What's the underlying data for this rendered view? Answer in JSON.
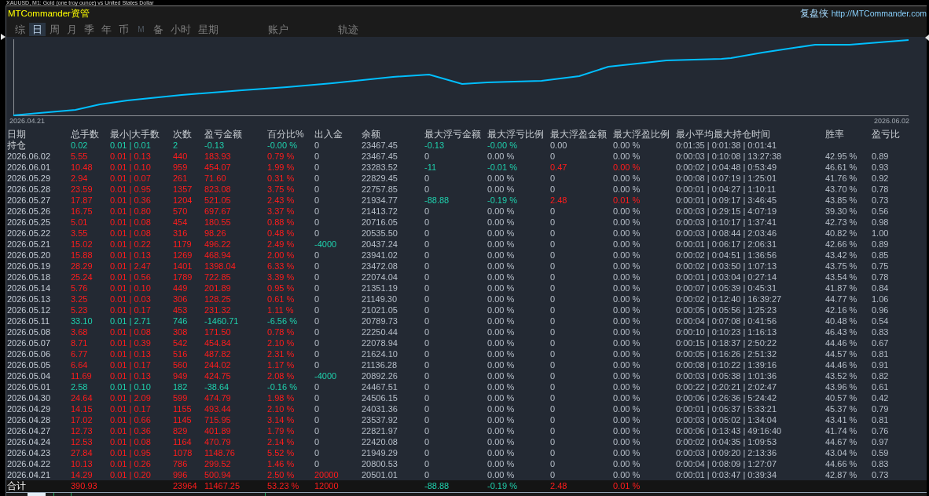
{
  "window": {
    "title": "XAUUSD, M1: Gold (one troy ounce) vs United States Dollar"
  },
  "header": {
    "brand": "MTCommander资管",
    "product": "复盘侠",
    "link": "http://MTCommander.com"
  },
  "tabs": [
    {
      "label": "综",
      "selected": false,
      "disabled": false
    },
    {
      "label": "日",
      "selected": true,
      "disabled": false
    },
    {
      "label": "周",
      "selected": false,
      "disabled": false
    },
    {
      "label": "月",
      "selected": false,
      "disabled": false
    },
    {
      "label": "季",
      "selected": false,
      "disabled": false
    },
    {
      "label": "年",
      "selected": false,
      "disabled": false
    },
    {
      "label": "币",
      "selected": false,
      "disabled": false
    },
    {
      "label": "M",
      "selected": false,
      "disabled": true
    },
    {
      "label": "备",
      "selected": false,
      "disabled": false
    },
    {
      "label": "小时",
      "selected": false,
      "disabled": false
    },
    {
      "label": "星期",
      "selected": false,
      "disabled": false
    },
    {
      "label": "账户",
      "selected": false,
      "disabled": false
    },
    {
      "label": "轨迹",
      "selected": false,
      "disabled": false
    }
  ],
  "equity_chart": {
    "start_label": "2026.04.21",
    "end_label": "2026.06.02"
  },
  "table": {
    "columns": [
      "日期",
      "总手数",
      "最小|大手数",
      "次数",
      "盈亏金额",
      "百分比%",
      "出入金",
      "余额",
      "最大浮亏金额",
      "最大浮亏比例",
      "最大浮盈金额",
      "最大浮盈比例",
      "最小平均最大持仓时间",
      "胜率",
      "盈亏比"
    ],
    "position_row": {
      "label": "持仓",
      "loss": true,
      "lots": "0.02",
      "lot_range": "0.01 | 0.01",
      "trades": "2",
      "profit": "-0.13",
      "percent": "-0.00 %",
      "cash_flow": "0",
      "deposit": false,
      "withdrawal": false,
      "balance": "23467.45",
      "float_loss": "-0.13",
      "float_loss_pct": "-0.00 %",
      "float_loss_hit": true,
      "float_gain": "0.00",
      "float_gain_pct": "0.00 %",
      "float_gain_hit": false,
      "hold_times": "0:01:35 | 0:01:38 | 0:01:41"
    },
    "rows": [
      {
        "label": "2026.06.02",
        "loss": false,
        "lots": "5.55",
        "lot_range": "0.01 | 0.13",
        "trades": "440",
        "profit": "183.93",
        "percent": "0.79 %",
        "cash_flow": "0",
        "deposit": false,
        "withdrawal": false,
        "balance": "23467.45",
        "float_loss": "0",
        "float_loss_pct": "0.00 %",
        "float_loss_hit": false,
        "float_gain": "0",
        "float_gain_pct": "0.00 %",
        "float_gain_hit": false,
        "hold_times": "0:00:03 | 0:10:08 | 13:27:38",
        "win_rate": "42.95 %",
        "pl_ratio": "0.89"
      },
      {
        "label": "2026.06.01",
        "loss": false,
        "lots": "10.48",
        "lot_range": "0.01 | 0.10",
        "trades": "959",
        "profit": "454.07",
        "percent": "1.99 %",
        "cash_flow": "0",
        "deposit": false,
        "withdrawal": false,
        "balance": "23283.52",
        "float_loss": "-11",
        "float_loss_pct": "-0.01 %",
        "float_loss_hit": true,
        "float_gain": "0.47",
        "float_gain_pct": "0.00 %",
        "float_gain_hit": true,
        "hold_times": "0:00:02 | 0:04:48 | 0:53:49",
        "win_rate": "46.61 %",
        "pl_ratio": "0.93"
      },
      {
        "label": "2026.05.29",
        "loss": false,
        "lots": "2.94",
        "lot_range": "0.01 | 0.07",
        "trades": "261",
        "profit": "71.60",
        "percent": "0.31 %",
        "cash_flow": "0",
        "deposit": false,
        "withdrawal": false,
        "balance": "22829.45",
        "float_loss": "0",
        "float_loss_pct": "0.00 %",
        "float_loss_hit": false,
        "float_gain": "0",
        "float_gain_pct": "0.00 %",
        "float_gain_hit": false,
        "hold_times": "0:00:08 | 0:07:19 | 1:25:01",
        "win_rate": "41.76 %",
        "pl_ratio": "0.92"
      },
      {
        "label": "2026.05.28",
        "loss": false,
        "lots": "23.59",
        "lot_range": "0.01 | 0.95",
        "trades": "1357",
        "profit": "823.08",
        "percent": "3.75 %",
        "cash_flow": "0",
        "deposit": false,
        "withdrawal": false,
        "balance": "22757.85",
        "float_loss": "0",
        "float_loss_pct": "0.00 %",
        "float_loss_hit": false,
        "float_gain": "0",
        "float_gain_pct": "0.00 %",
        "float_gain_hit": false,
        "hold_times": "0:00:01 | 0:04:27 | 1:10:11",
        "win_rate": "43.70 %",
        "pl_ratio": "0.78"
      },
      {
        "label": "2026.05.27",
        "loss": false,
        "lots": "17.87",
        "lot_range": "0.01 | 0.36",
        "trades": "1204",
        "profit": "521.05",
        "percent": "2.43 %",
        "cash_flow": "0",
        "deposit": false,
        "withdrawal": false,
        "balance": "21934.77",
        "float_loss": "-88.88",
        "float_loss_pct": "-0.19 %",
        "float_loss_hit": true,
        "float_gain": "2.48",
        "float_gain_pct": "0.01 %",
        "float_gain_hit": true,
        "hold_times": "0:00:01 | 0:09:17 | 3:46:45",
        "win_rate": "43.85 %",
        "pl_ratio": "0.73"
      },
      {
        "label": "2026.05.26",
        "loss": false,
        "lots": "16.75",
        "lot_range": "0.01 | 0.80",
        "trades": "570",
        "profit": "697.67",
        "percent": "3.37 %",
        "cash_flow": "0",
        "deposit": false,
        "withdrawal": false,
        "balance": "21413.72",
        "float_loss": "0",
        "float_loss_pct": "0.00 %",
        "float_loss_hit": false,
        "float_gain": "0",
        "float_gain_pct": "0.00 %",
        "float_gain_hit": false,
        "hold_times": "0:00:03 | 0:29:15 | 4:07:19",
        "win_rate": "39.30 %",
        "pl_ratio": "0.56"
      },
      {
        "label": "2026.05.25",
        "loss": false,
        "lots": "5.01",
        "lot_range": "0.01 | 0.08",
        "trades": "454",
        "profit": "180.55",
        "percent": "0.88 %",
        "cash_flow": "0",
        "deposit": false,
        "withdrawal": false,
        "balance": "20716.05",
        "float_loss": "0",
        "float_loss_pct": "0.00 %",
        "float_loss_hit": false,
        "float_gain": "0",
        "float_gain_pct": "0.00 %",
        "float_gain_hit": false,
        "hold_times": "0:00:03 | 0:10:17 | 1:37:41",
        "win_rate": "42.73 %",
        "pl_ratio": "0.98"
      },
      {
        "label": "2026.05.22",
        "loss": false,
        "lots": "3.55",
        "lot_range": "0.01 | 0.08",
        "trades": "316",
        "profit": "98.26",
        "percent": "0.48 %",
        "cash_flow": "0",
        "deposit": false,
        "withdrawal": false,
        "balance": "20535.50",
        "float_loss": "0",
        "float_loss_pct": "0.00 %",
        "float_loss_hit": false,
        "float_gain": "0",
        "float_gain_pct": "0.00 %",
        "float_gain_hit": false,
        "hold_times": "0:00:03 | 0:08:44 | 2:03:46",
        "win_rate": "40.82 %",
        "pl_ratio": "1.00"
      },
      {
        "label": "2026.05.21",
        "loss": false,
        "lots": "15.02",
        "lot_range": "0.01 | 0.22",
        "trades": "1179",
        "profit": "496.22",
        "percent": "2.49 %",
        "cash_flow": "-4000",
        "deposit": false,
        "withdrawal": true,
        "balance": "20437.24",
        "float_loss": "0",
        "float_loss_pct": "0.00 %",
        "float_loss_hit": false,
        "float_gain": "0",
        "float_gain_pct": "0.00 %",
        "float_gain_hit": false,
        "hold_times": "0:00:01 | 0:06:17 | 2:06:31",
        "win_rate": "42.66 %",
        "pl_ratio": "0.89"
      },
      {
        "label": "2026.05.20",
        "loss": false,
        "lots": "15.88",
        "lot_range": "0.01 | 0.13",
        "trades": "1269",
        "profit": "468.94",
        "percent": "2.00 %",
        "cash_flow": "0",
        "deposit": false,
        "withdrawal": false,
        "balance": "23941.02",
        "float_loss": "0",
        "float_loss_pct": "0.00 %",
        "float_loss_hit": false,
        "float_gain": "0",
        "float_gain_pct": "0.00 %",
        "float_gain_hit": false,
        "hold_times": "0:00:02 | 0:04:51 | 1:36:56",
        "win_rate": "43.42 %",
        "pl_ratio": "0.85"
      },
      {
        "label": "2026.05.19",
        "loss": false,
        "lots": "28.29",
        "lot_range": "0.01 | 2.47",
        "trades": "1401",
        "profit": "1398.04",
        "percent": "6.33 %",
        "cash_flow": "0",
        "deposit": false,
        "withdrawal": false,
        "balance": "23472.08",
        "float_loss": "0",
        "float_loss_pct": "0.00 %",
        "float_loss_hit": false,
        "float_gain": "0",
        "float_gain_pct": "0.00 %",
        "float_gain_hit": false,
        "hold_times": "0:00:02 | 0:03:50 | 1:07:13",
        "win_rate": "43.75 %",
        "pl_ratio": "0.75"
      },
      {
        "label": "2026.05.18",
        "loss": false,
        "lots": "25.24",
        "lot_range": "0.01 | 0.56",
        "trades": "1789",
        "profit": "722.85",
        "percent": "3.39 %",
        "cash_flow": "0",
        "deposit": false,
        "withdrawal": false,
        "balance": "22074.04",
        "float_loss": "0",
        "float_loss_pct": "0.00 %",
        "float_loss_hit": false,
        "float_gain": "0",
        "float_gain_pct": "0.00 %",
        "float_gain_hit": false,
        "hold_times": "0:00:01 | 0:03:04 | 0:27:14",
        "win_rate": "43.54 %",
        "pl_ratio": "0.78"
      },
      {
        "label": "2026.05.14",
        "loss": false,
        "lots": "5.76",
        "lot_range": "0.01 | 0.10",
        "trades": "449",
        "profit": "201.89",
        "percent": "0.95 %",
        "cash_flow": "0",
        "deposit": false,
        "withdrawal": false,
        "balance": "21351.19",
        "float_loss": "0",
        "float_loss_pct": "0.00 %",
        "float_loss_hit": false,
        "float_gain": "0",
        "float_gain_pct": "0.00 %",
        "float_gain_hit": false,
        "hold_times": "0:00:07 | 0:05:39 | 0:45:31",
        "win_rate": "41.87 %",
        "pl_ratio": "0.84"
      },
      {
        "label": "2026.05.13",
        "loss": false,
        "lots": "3.25",
        "lot_range": "0.01 | 0.03",
        "trades": "306",
        "profit": "128.25",
        "percent": "0.61 %",
        "cash_flow": "0",
        "deposit": false,
        "withdrawal": false,
        "balance": "21149.30",
        "float_loss": "0",
        "float_loss_pct": "0.00 %",
        "float_loss_hit": false,
        "float_gain": "0",
        "float_gain_pct": "0.00 %",
        "float_gain_hit": false,
        "hold_times": "0:00:02 | 0:12:40 | 16:39:27",
        "win_rate": "44.77 %",
        "pl_ratio": "1.06"
      },
      {
        "label": "2026.05.12",
        "loss": false,
        "lots": "5.23",
        "lot_range": "0.01 | 0.17",
        "trades": "453",
        "profit": "231.32",
        "percent": "1.11 %",
        "cash_flow": "0",
        "deposit": false,
        "withdrawal": false,
        "balance": "21021.05",
        "float_loss": "0",
        "float_loss_pct": "0.00 %",
        "float_loss_hit": false,
        "float_gain": "0",
        "float_gain_pct": "0.00 %",
        "float_gain_hit": false,
        "hold_times": "0:00:05 | 0:05:56 | 1:25:23",
        "win_rate": "42.16 %",
        "pl_ratio": "0.96"
      },
      {
        "label": "2026.05.11",
        "loss": true,
        "lots": "33.10",
        "lot_range": "0.01 | 2.71",
        "trades": "746",
        "profit": "-1460.71",
        "percent": "-6.56 %",
        "cash_flow": "0",
        "deposit": false,
        "withdrawal": false,
        "balance": "20789.73",
        "float_loss": "0",
        "float_loss_pct": "0.00 %",
        "float_loss_hit": false,
        "float_gain": "0",
        "float_gain_pct": "0.00 %",
        "float_gain_hit": false,
        "hold_times": "0:00:04 | 0:07:08 | 0:41:56",
        "win_rate": "40.48 %",
        "pl_ratio": "0.54"
      },
      {
        "label": "2026.05.08",
        "loss": false,
        "lots": "3.68",
        "lot_range": "0.01 | 0.08",
        "trades": "308",
        "profit": "171.50",
        "percent": "0.78 %",
        "cash_flow": "0",
        "deposit": false,
        "withdrawal": false,
        "balance": "22250.44",
        "float_loss": "0",
        "float_loss_pct": "0.00 %",
        "float_loss_hit": false,
        "float_gain": "0",
        "float_gain_pct": "0.00 %",
        "float_gain_hit": false,
        "hold_times": "0:00:10 | 0:10:23 | 1:16:13",
        "win_rate": "46.43 %",
        "pl_ratio": "0.83"
      },
      {
        "label": "2026.05.07",
        "loss": false,
        "lots": "8.71",
        "lot_range": "0.01 | 0.39",
        "trades": "542",
        "profit": "454.84",
        "percent": "2.10 %",
        "cash_flow": "0",
        "deposit": false,
        "withdrawal": false,
        "balance": "22078.94",
        "float_loss": "0",
        "float_loss_pct": "0.00 %",
        "float_loss_hit": false,
        "float_gain": "0",
        "float_gain_pct": "0.00 %",
        "float_gain_hit": false,
        "hold_times": "0:00:15 | 0:18:37 | 2:50:22",
        "win_rate": "44.46 %",
        "pl_ratio": "0.67"
      },
      {
        "label": "2026.05.06",
        "loss": false,
        "lots": "6.77",
        "lot_range": "0.01 | 0.13",
        "trades": "516",
        "profit": "487.82",
        "percent": "2.31 %",
        "cash_flow": "0",
        "deposit": false,
        "withdrawal": false,
        "balance": "21624.10",
        "float_loss": "0",
        "float_loss_pct": "0.00 %",
        "float_loss_hit": false,
        "float_gain": "0",
        "float_gain_pct": "0.00 %",
        "float_gain_hit": false,
        "hold_times": "0:00:05 | 0:16:26 | 2:51:32",
        "win_rate": "44.57 %",
        "pl_ratio": "0.81"
      },
      {
        "label": "2026.05.05",
        "loss": false,
        "lots": "6.64",
        "lot_range": "0.01 | 0.17",
        "trades": "560",
        "profit": "244.02",
        "percent": "1.17 %",
        "cash_flow": "0",
        "deposit": false,
        "withdrawal": false,
        "balance": "21136.28",
        "float_loss": "0",
        "float_loss_pct": "0.00 %",
        "float_loss_hit": false,
        "float_gain": "0",
        "float_gain_pct": "0.00 %",
        "float_gain_hit": false,
        "hold_times": "0:00:08 | 0:10:22 | 1:39:16",
        "win_rate": "44.46 %",
        "pl_ratio": "0.91"
      },
      {
        "label": "2026.05.04",
        "loss": false,
        "lots": "11.69",
        "lot_range": "0.01 | 0.13",
        "trades": "949",
        "profit": "424.75",
        "percent": "2.08 %",
        "cash_flow": "-4000",
        "deposit": false,
        "withdrawal": true,
        "balance": "20892.26",
        "float_loss": "0",
        "float_loss_pct": "0.00 %",
        "float_loss_hit": false,
        "float_gain": "0",
        "float_gain_pct": "0.00 %",
        "float_gain_hit": false,
        "hold_times": "0:00:03 | 0:05:38 | 1:01:36",
        "win_rate": "43.52 %",
        "pl_ratio": "0.82"
      },
      {
        "label": "2026.05.01",
        "loss": true,
        "lots": "2.58",
        "lot_range": "0.01 | 0.10",
        "trades": "182",
        "profit": "-38.64",
        "percent": "-0.16 %",
        "cash_flow": "0",
        "deposit": false,
        "withdrawal": false,
        "balance": "24467.51",
        "float_loss": "0",
        "float_loss_pct": "0.00 %",
        "float_loss_hit": false,
        "float_gain": "0",
        "float_gain_pct": "0.00 %",
        "float_gain_hit": false,
        "hold_times": "0:00:22 | 0:20:21 | 2:02:47",
        "win_rate": "43.96 %",
        "pl_ratio": "0.61"
      },
      {
        "label": "2026.04.30",
        "loss": false,
        "lots": "24.64",
        "lot_range": "0.01 | 2.09",
        "trades": "599",
        "profit": "474.79",
        "percent": "1.98 %",
        "cash_flow": "0",
        "deposit": false,
        "withdrawal": false,
        "balance": "24506.15",
        "float_loss": "0",
        "float_loss_pct": "0.00 %",
        "float_loss_hit": false,
        "float_gain": "0",
        "float_gain_pct": "0.00 %",
        "float_gain_hit": false,
        "hold_times": "0:00:06 | 0:26:36 | 5:24:42",
        "win_rate": "40.57 %",
        "pl_ratio": "0.42"
      },
      {
        "label": "2026.04.29",
        "loss": false,
        "lots": "14.15",
        "lot_range": "0.01 | 0.17",
        "trades": "1155",
        "profit": "493.44",
        "percent": "2.10 %",
        "cash_flow": "0",
        "deposit": false,
        "withdrawal": false,
        "balance": "24031.36",
        "float_loss": "0",
        "float_loss_pct": "0.00 %",
        "float_loss_hit": false,
        "float_gain": "0",
        "float_gain_pct": "0.00 %",
        "float_gain_hit": false,
        "hold_times": "0:00:01 | 0:05:37 | 5:33:21",
        "win_rate": "45.37 %",
        "pl_ratio": "0.79"
      },
      {
        "label": "2026.04.28",
        "loss": false,
        "lots": "17.02",
        "lot_range": "0.01 | 0.66",
        "trades": "1145",
        "profit": "715.95",
        "percent": "3.14 %",
        "cash_flow": "0",
        "deposit": false,
        "withdrawal": false,
        "balance": "23537.92",
        "float_loss": "0",
        "float_loss_pct": "0.00 %",
        "float_loss_hit": false,
        "float_gain": "0",
        "float_gain_pct": "0.00 %",
        "float_gain_hit": false,
        "hold_times": "0:00:03 | 0:05:02 | 1:34:04",
        "win_rate": "43.41 %",
        "pl_ratio": "0.81"
      },
      {
        "label": "2026.04.27",
        "loss": false,
        "lots": "12.73",
        "lot_range": "0.01 | 0.36",
        "trades": "829",
        "profit": "401.89",
        "percent": "1.79 %",
        "cash_flow": "0",
        "deposit": false,
        "withdrawal": false,
        "balance": "22821.97",
        "float_loss": "0",
        "float_loss_pct": "0.00 %",
        "float_loss_hit": false,
        "float_gain": "0",
        "float_gain_pct": "0.00 %",
        "float_gain_hit": false,
        "hold_times": "0:00:06 | 0:13:43 | 49:16:40",
        "win_rate": "41.74 %",
        "pl_ratio": "0.76"
      },
      {
        "label": "2026.04.24",
        "loss": false,
        "lots": "12.53",
        "lot_range": "0.01 | 0.08",
        "trades": "1164",
        "profit": "470.79",
        "percent": "2.14 %",
        "cash_flow": "0",
        "deposit": false,
        "withdrawal": false,
        "balance": "22420.08",
        "float_loss": "0",
        "float_loss_pct": "0.00 %",
        "float_loss_hit": false,
        "float_gain": "0",
        "float_gain_pct": "0.00 %",
        "float_gain_hit": false,
        "hold_times": "0:00:02 | 0:04:35 | 1:09:53",
        "win_rate": "44.67 %",
        "pl_ratio": "0.97"
      },
      {
        "label": "2026.04.23",
        "loss": false,
        "lots": "27.84",
        "lot_range": "0.01 | 0.95",
        "trades": "1078",
        "profit": "1148.76",
        "percent": "5.52 %",
        "cash_flow": "0",
        "deposit": false,
        "withdrawal": false,
        "balance": "21949.29",
        "float_loss": "0",
        "float_loss_pct": "0.00 %",
        "float_loss_hit": false,
        "float_gain": "0",
        "float_gain_pct": "0.00 %",
        "float_gain_hit": false,
        "hold_times": "0:00:03 | 0:09:20 | 2:13:36",
        "win_rate": "43.04 %",
        "pl_ratio": "0.59"
      },
      {
        "label": "2026.04.22",
        "loss": false,
        "lots": "10.13",
        "lot_range": "0.01 | 0.26",
        "trades": "786",
        "profit": "299.52",
        "percent": "1.46 %",
        "cash_flow": "0",
        "deposit": false,
        "withdrawal": false,
        "balance": "20800.53",
        "float_loss": "0",
        "float_loss_pct": "0.00 %",
        "float_loss_hit": false,
        "float_gain": "0",
        "float_gain_pct": "0.00 %",
        "float_gain_hit": false,
        "hold_times": "0:00:04 | 0:08:09 | 1:27:07",
        "win_rate": "44.66 %",
        "pl_ratio": "0.83"
      },
      {
        "label": "2026.04.21",
        "loss": false,
        "lots": "14.29",
        "lot_range": "0.01 | 0.20",
        "trades": "996",
        "profit": "500.94",
        "percent": "2.50 %",
        "cash_flow": "20000",
        "deposit": true,
        "withdrawal": false,
        "balance": "20501.01",
        "float_loss": "0",
        "float_loss_pct": "0.00 %",
        "float_loss_hit": false,
        "float_gain": "0",
        "float_gain_pct": "0.00 %",
        "float_gain_hit": false,
        "hold_times": "0:00:01 | 0:03:47 | 0:39:34",
        "win_rate": "42.87 %",
        "pl_ratio": "0.73"
      }
    ],
    "total_row": {
      "label": "合计",
      "loss": false,
      "lots": "390.93",
      "trades": "23964",
      "profit": "11467.25",
      "percent": "53.23 %",
      "cash_flow": "12000",
      "deposit": true,
      "withdrawal": false,
      "float_loss": "-88.88",
      "float_loss_pct": "-0.19 %",
      "float_loss_hit": true,
      "float_gain": "2.48",
      "float_gain_pct": "0.01 %",
      "float_gain_hit": true
    }
  }
}
